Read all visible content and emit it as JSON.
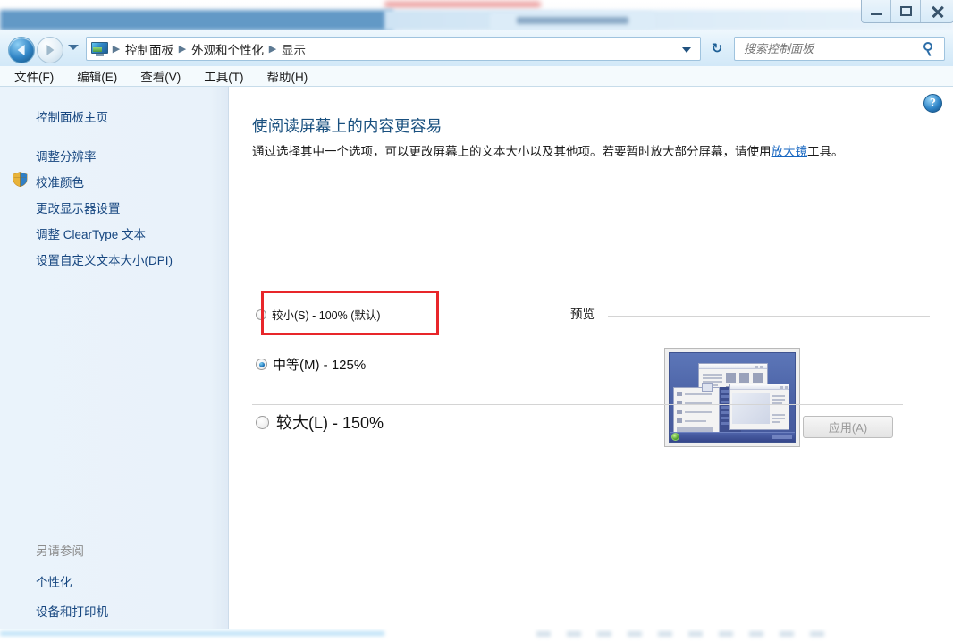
{
  "window": {
    "controls": [
      {
        "name": "minimize",
        "label": "最小化"
      },
      {
        "name": "maximize",
        "label": "最大化"
      },
      {
        "name": "close",
        "label": "关闭"
      }
    ]
  },
  "navigation": {
    "back_label": "后退",
    "forward_label": "前进",
    "history_label": "最近浏览的位置",
    "refresh_label": "刷新",
    "breadcrumb": {
      "icon": "display-icon",
      "separator": "▶",
      "items": [
        {
          "label": "控制面板"
        },
        {
          "label": "外观和个性化"
        },
        {
          "label": "显示"
        }
      ]
    },
    "address_dropdown_label": "以前的位置"
  },
  "search": {
    "placeholder": "搜索控制面板",
    "value": "",
    "icon": "search-icon"
  },
  "menubar": {
    "items": [
      {
        "label": "文件(F)"
      },
      {
        "label": "编辑(E)"
      },
      {
        "label": "查看(V)"
      },
      {
        "label": "工具(T)"
      },
      {
        "label": "帮助(H)"
      }
    ]
  },
  "sidebar": {
    "home": {
      "label": "控制面板主页"
    },
    "links": [
      {
        "label": "调整分辨率",
        "shield": false
      },
      {
        "label": "校准颜色",
        "shield": true
      },
      {
        "label": "更改显示器设置",
        "shield": false
      },
      {
        "label": "调整 ClearType 文本",
        "shield": false
      },
      {
        "label": "设置自定义文本大小(DPI)",
        "shield": false
      }
    ],
    "see_also": {
      "heading": "另请参阅",
      "links": [
        {
          "label": "个性化"
        },
        {
          "label": "设备和打印机"
        }
      ]
    }
  },
  "main": {
    "help_glyph": "?",
    "help_label": "帮助",
    "title": "使阅读屏幕上的内容更容易",
    "description": {
      "before_link": "通过选择其中一个选项，可以更改屏幕上的文本大小以及其他项。若要暂时放大部分屏幕，请使用",
      "link": "放大镜",
      "after_link": "工具。"
    },
    "scaling_options": [
      {
        "label": "较小(S) - 100% (默认)",
        "percent": "100%",
        "selected": false,
        "highlighted": true
      },
      {
        "label": "中等(M) - 125%",
        "percent": "125%",
        "selected": true,
        "highlighted": false
      },
      {
        "label": "较大(L) - 150%",
        "percent": "150%",
        "selected": false,
        "highlighted": false
      }
    ],
    "preview": {
      "label": "预览",
      "thumbnail_name": "desktop-preview-thumbnail"
    },
    "apply_button": {
      "label": "应用(A)",
      "enabled": false
    }
  },
  "colors": {
    "accent_blue": "#19507f",
    "link_blue": "#15457f",
    "highlight_red": "#e8262a",
    "chrome_blue": "#d2e8f8",
    "sidebar_bg": "#eaf3fb"
  }
}
